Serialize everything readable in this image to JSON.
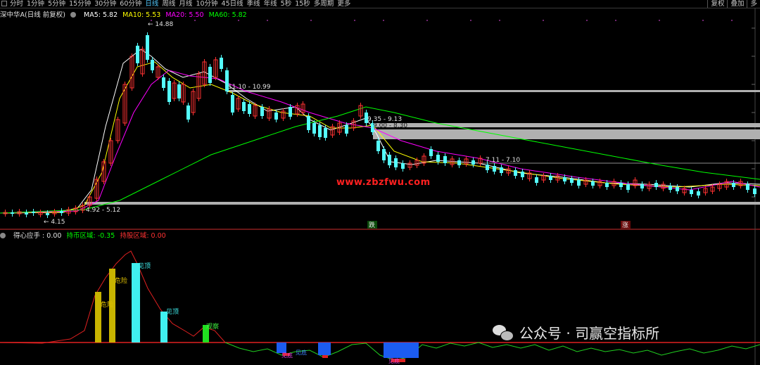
{
  "toolbar": {
    "tabs": [
      "分时",
      "1分钟",
      "5分钟",
      "15分钟",
      "30分钟",
      "60分钟",
      "日线",
      "周线",
      "月线",
      "10分钟",
      "45日线",
      "季线",
      "年线",
      "5秒",
      "15秒",
      "多周期",
      "更多"
    ],
    "active_tab": "日线",
    "right_buttons": [
      "复权",
      "叠加",
      "多"
    ]
  },
  "main_info": {
    "title": "深中华A(日线 前复权)",
    "ma5": "MA5: 5.82",
    "ma10": "MA10: 5.53",
    "ma20": "MA20: 5.50",
    "ma60": "MA60: 5.82"
  },
  "annotations": {
    "high": "14.88",
    "r1": "11.10 - 10.99",
    "r2": "9.35 - 9.13",
    "r3": "9.00 - 8.30",
    "r4": "7.11 - 7.10",
    "s1": "4.92 - 5.12",
    "low": "4.15",
    "signal_down": "跌",
    "signal_up": "涨"
  },
  "watermark": "www.zbzfwu.com",
  "indicator": {
    "name": "得心应手 : 0.00",
    "hold_coin": "持币区域: -0.35",
    "hold_stock": "持股区域: 0.00",
    "bar_labels": [
      "危险",
      "危险",
      "见顶",
      "见顶",
      "观察"
    ],
    "bottom_labels": [
      "见底",
      "见底",
      "见底"
    ]
  },
  "wechat": {
    "text": "公众号 · 司赢空指标所"
  },
  "colors": {
    "bg": "#000000",
    "up": "#ff3232",
    "down": "#54fcfc",
    "ma5": "#ffffff",
    "ma10": "#ffff00",
    "ma20": "#ff00ff",
    "ma60": "#00ff00",
    "resistance": "#b0b0b0"
  }
}
